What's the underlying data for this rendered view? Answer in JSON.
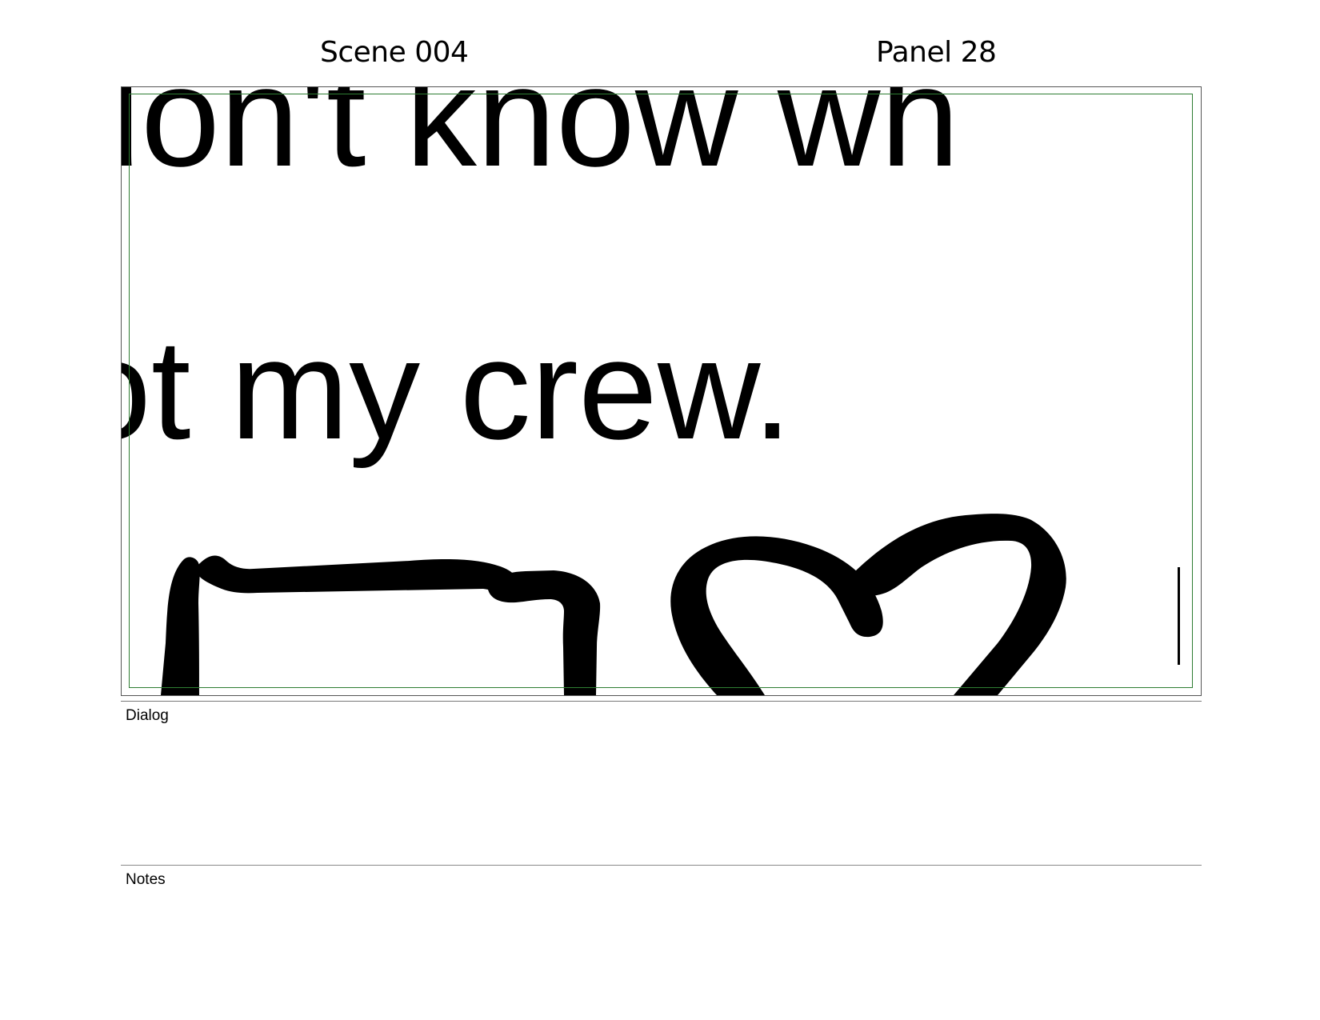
{
  "header": {
    "scene": "Scene 004",
    "panel": "Panel 28"
  },
  "panel_art": {
    "lettering_line_1": "don't know wh",
    "lettering_line_2": "ot my crew.",
    "drawing": "hand-drawn-stroke-shapes",
    "safe_area_color": "#2e7d32"
  },
  "sections": {
    "dialog_label": "Dialog",
    "notes_label": "Notes"
  }
}
